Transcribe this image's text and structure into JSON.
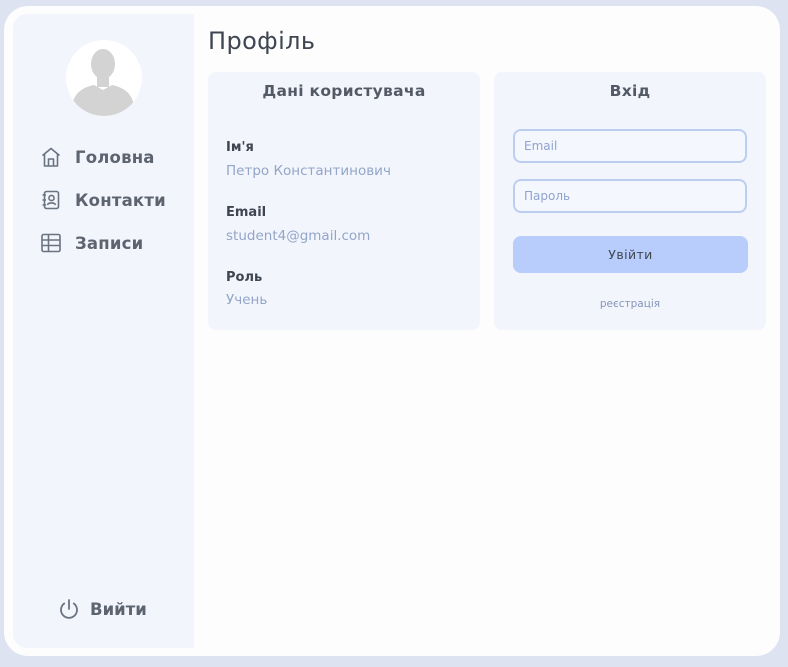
{
  "page": {
    "title": "Профіль"
  },
  "sidebar": {
    "items": [
      {
        "label": "Головна",
        "icon": "home-icon"
      },
      {
        "label": "Контакти",
        "icon": "contacts-icon"
      },
      {
        "label": "Записи",
        "icon": "table-icon"
      }
    ],
    "logout_label": "Вийти",
    "logout_icon": "power-icon"
  },
  "user_card": {
    "title": "Дані користувача",
    "fields": [
      {
        "label": "Ім'я",
        "value": "Петро Константинович"
      },
      {
        "label": "Email",
        "value": "student4@gmail.com"
      },
      {
        "label": "Роль",
        "value": "Учень"
      }
    ]
  },
  "login_card": {
    "title": "Вхід",
    "email_placeholder": "Email",
    "password_placeholder": "Пароль",
    "submit_label": "Увійти",
    "register_label": "реєстрація"
  },
  "colors": {
    "background": "#dde3f0",
    "panel": "#f2f5fc",
    "accent_button": "#b8cdfb",
    "input_border": "#bccdf2",
    "value_text": "#93a5c8"
  }
}
